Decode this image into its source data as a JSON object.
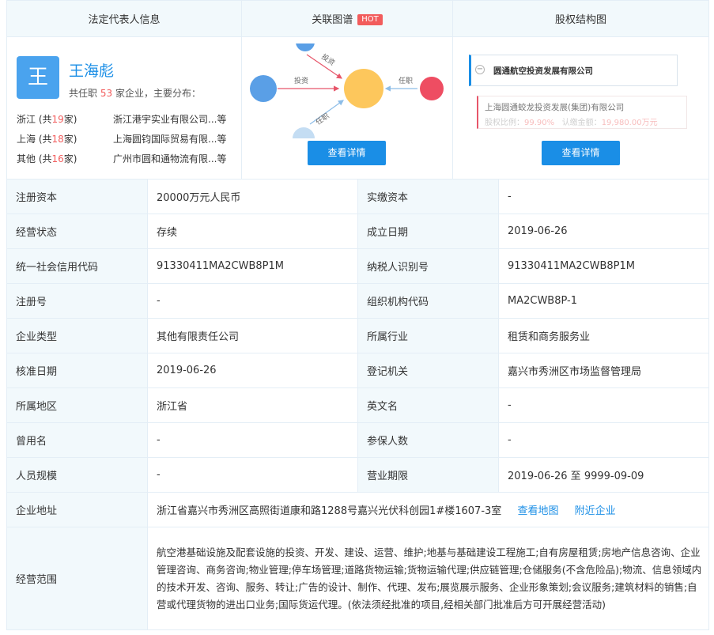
{
  "header": {
    "col1": "法定代表人信息",
    "col2": "关联图谱",
    "col2_badge": "HOT",
    "col3": "股权结构图"
  },
  "person": {
    "avatar_char": "王",
    "name": "王海彪",
    "desc_prefix": "共任职",
    "desc_count": "53",
    "desc_suffix": "家企业，主要分布：",
    "distribution": [
      {
        "region": "浙江 (共",
        "count": "19",
        "unit": "家)",
        "company": "浙江港宇实业有限公司...等"
      },
      {
        "region": "上海 (共",
        "count": "18",
        "unit": "家)",
        "company": "上海圆钧国际贸易有限...等"
      },
      {
        "region": "其他 (共",
        "count": "16",
        "unit": "家)",
        "company": "广州市圆和通物流有限...等"
      }
    ]
  },
  "graph": {
    "edge_invest": "投资",
    "edge_invest2": "投资",
    "edge_job": "任职",
    "edge_job2": "任职",
    "button": "查看详情"
  },
  "equity": {
    "company": "圆通航空投资发展有限公司",
    "sub_company": "上海圆通蛟龙投资发展(集团)有限公司",
    "ratio_label": "股权比例：",
    "ratio_value": "99.90%",
    "amount_label": "认缴金额：",
    "amount_value": "19,980.00万元",
    "button": "查看详情"
  },
  "info": {
    "reg_capital_label": "注册资本",
    "reg_capital": "20000万元人民币",
    "paid_capital_label": "实缴资本",
    "paid_capital": "-",
    "status_label": "经营状态",
    "status": "存续",
    "found_label": "成立日期",
    "found": "2019-06-26",
    "credit_label": "统一社会信用代码",
    "credit": "91330411MA2CWB8P1M",
    "tax_label": "纳税人识别号",
    "tax": "91330411MA2CWB8P1M",
    "regno_label": "注册号",
    "regno": "-",
    "org_label": "组织机构代码",
    "org": "MA2CWB8P-1",
    "type_label": "企业类型",
    "type": "其他有限责任公司",
    "industry_label": "所属行业",
    "industry": "租赁和商务服务业",
    "approve_label": "核准日期",
    "approve": "2019-06-26",
    "authority_label": "登记机关",
    "authority": "嘉兴市秀洲区市场监督管理局",
    "area_label": "所属地区",
    "area": "浙江省",
    "en_label": "英文名",
    "en": "-",
    "former_label": "曾用名",
    "former": "-",
    "insured_label": "参保人数",
    "insured": "-",
    "staff_label": "人员规模",
    "staff": "-",
    "term_label": "营业期限",
    "term": "2019-06-26 至 9999-09-09",
    "address_label": "企业地址",
    "address": "浙江省嘉兴市秀洲区高照街道康和路1288号嘉兴光伏科创园1#楼1607-3室",
    "map_link": "查看地图",
    "nearby_link": "附近企业",
    "scope_label": "经营范围",
    "scope": "航空港基础设施及配套设施的投资、开发、建设、运营、维护;地基与基础建设工程施工;自有房屋租赁;房地产信息咨询、企业管理咨询、商务咨询;物业管理;停车场管理;道路货物运输;货物运输代理;供应链管理;仓储服务(不含危险品);物流、信息领域内的技术开发、咨询、服务、转让;广告的设计、制作、代理、发布;展览展示服务、企业形象策划;会议服务;建筑材料的销售;自营或代理货物的进出口业务;国际货运代理。(依法须经批准的项目,经相关部门批准后方可开展经营活动)"
  },
  "colors": {
    "accent": "#1a8ee6",
    "label_bg": "#f2f9fc",
    "highlight": "#f25c5c"
  }
}
